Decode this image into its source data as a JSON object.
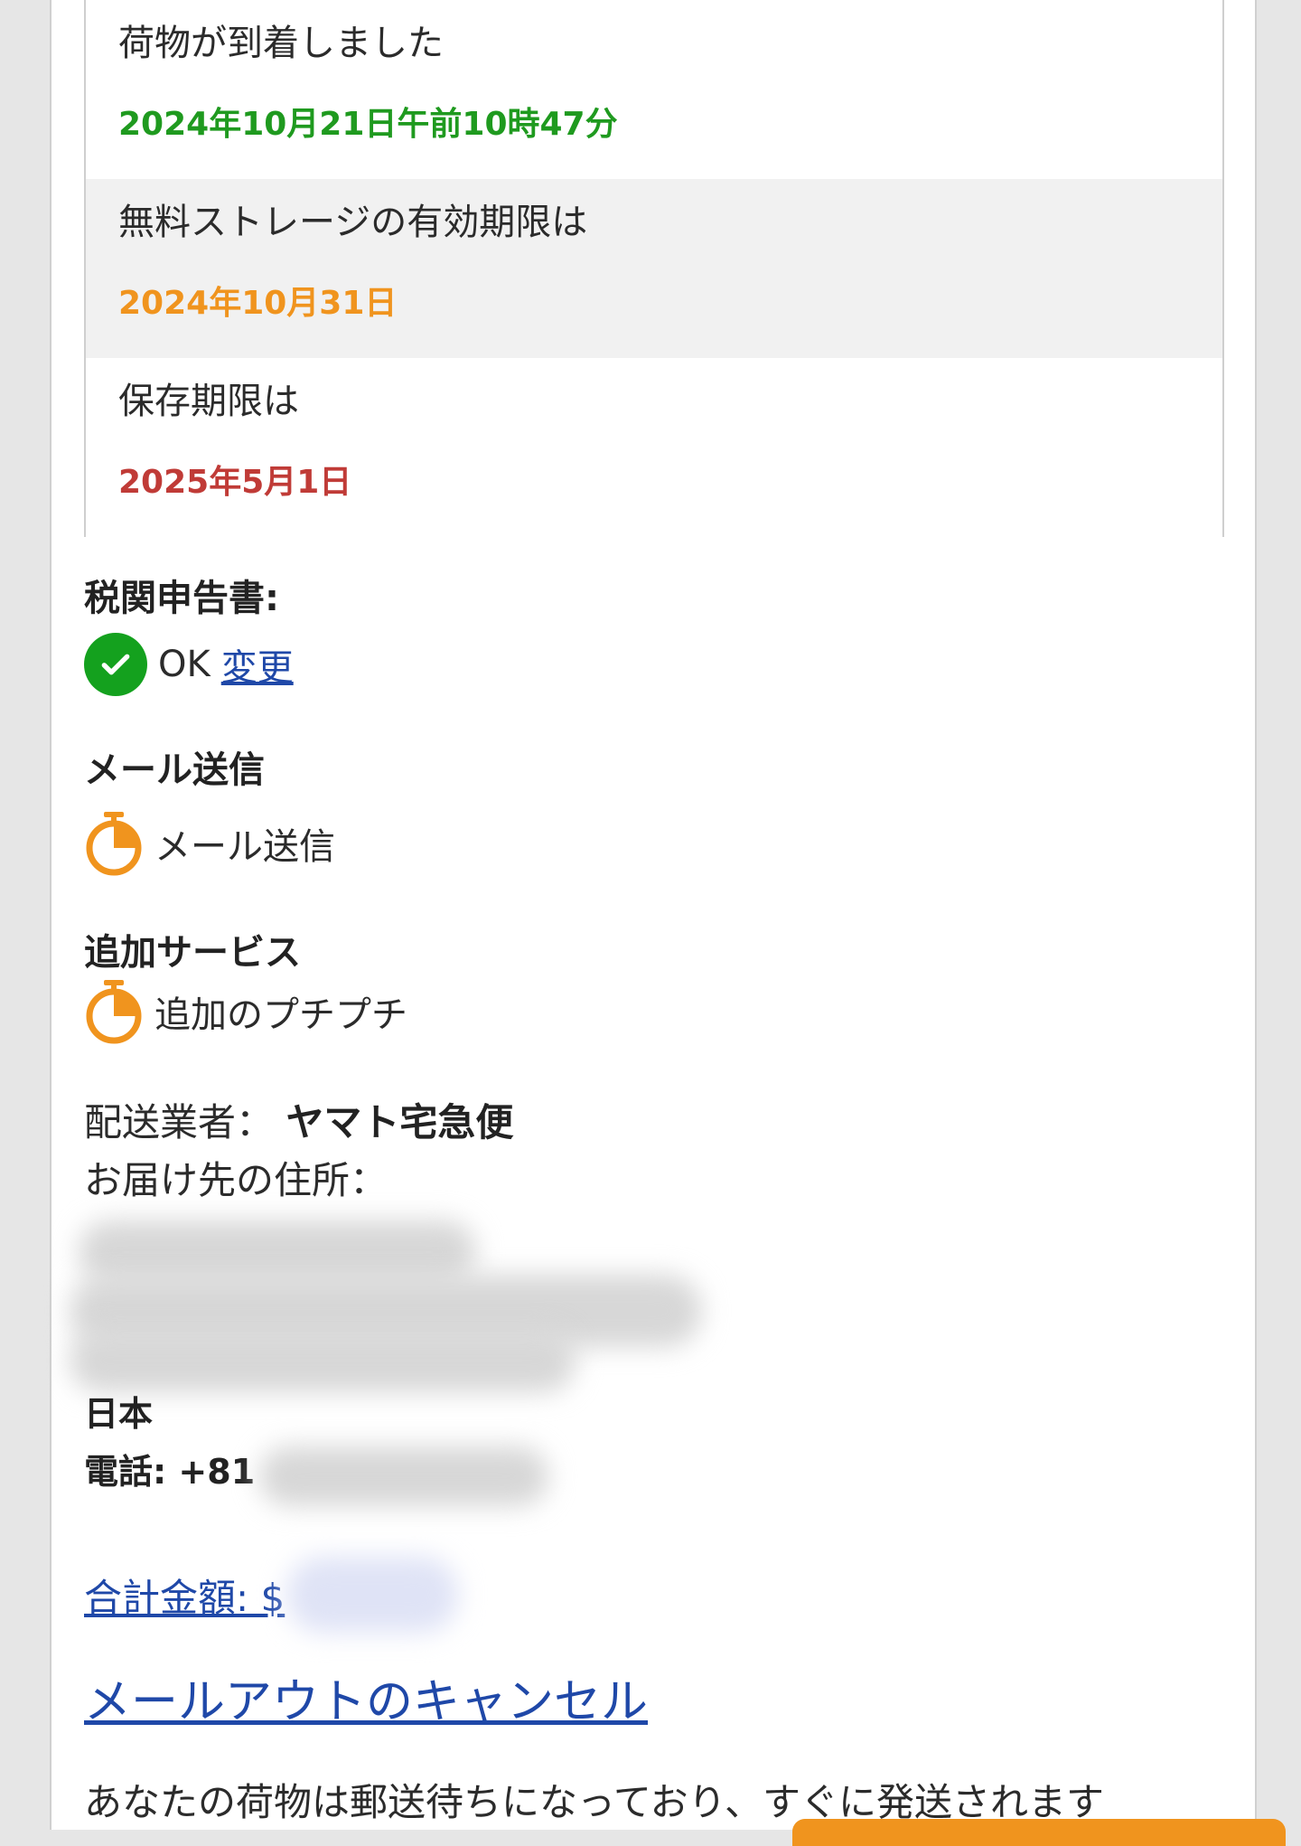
{
  "timeline": [
    {
      "label": "荷物が到着しました",
      "date": "2024年10月21日午前10時47分",
      "date_color": "#1f9a1f"
    },
    {
      "label": "無料ストレージの有効期限は",
      "date": "2024年10月31日",
      "date_color": "#f0941e"
    },
    {
      "label": "保存期限は",
      "date": "2025年5月1日",
      "date_color": "#c03b37"
    }
  ],
  "customs": {
    "title": "税関申告書:",
    "status": "OK",
    "change_link": "変更",
    "icon": "check-circle-icon"
  },
  "mail": {
    "title": "メール送信",
    "status": "メール送信",
    "icon": "stopwatch-icon"
  },
  "extra": {
    "title": "追加サービス",
    "status": "追加のプチプチ",
    "icon": "stopwatch-icon"
  },
  "shipping": {
    "carrier_label": "配送業者：",
    "carrier_value": "ヤマト宅急便",
    "address_label": "お届け先の住所：",
    "country": "日本",
    "phone": "電話: +81"
  },
  "total": {
    "label": "合計金額: $"
  },
  "cancel_link": "メールアウトのキャンセル",
  "footer": "あなたの荷物は郵送待ちになっており、すぐに発送されます",
  "colors": {
    "link": "#1f48a8",
    "ok_green": "#14a11e",
    "pending_orange": "#f0941e",
    "expire_red": "#c03b37"
  }
}
